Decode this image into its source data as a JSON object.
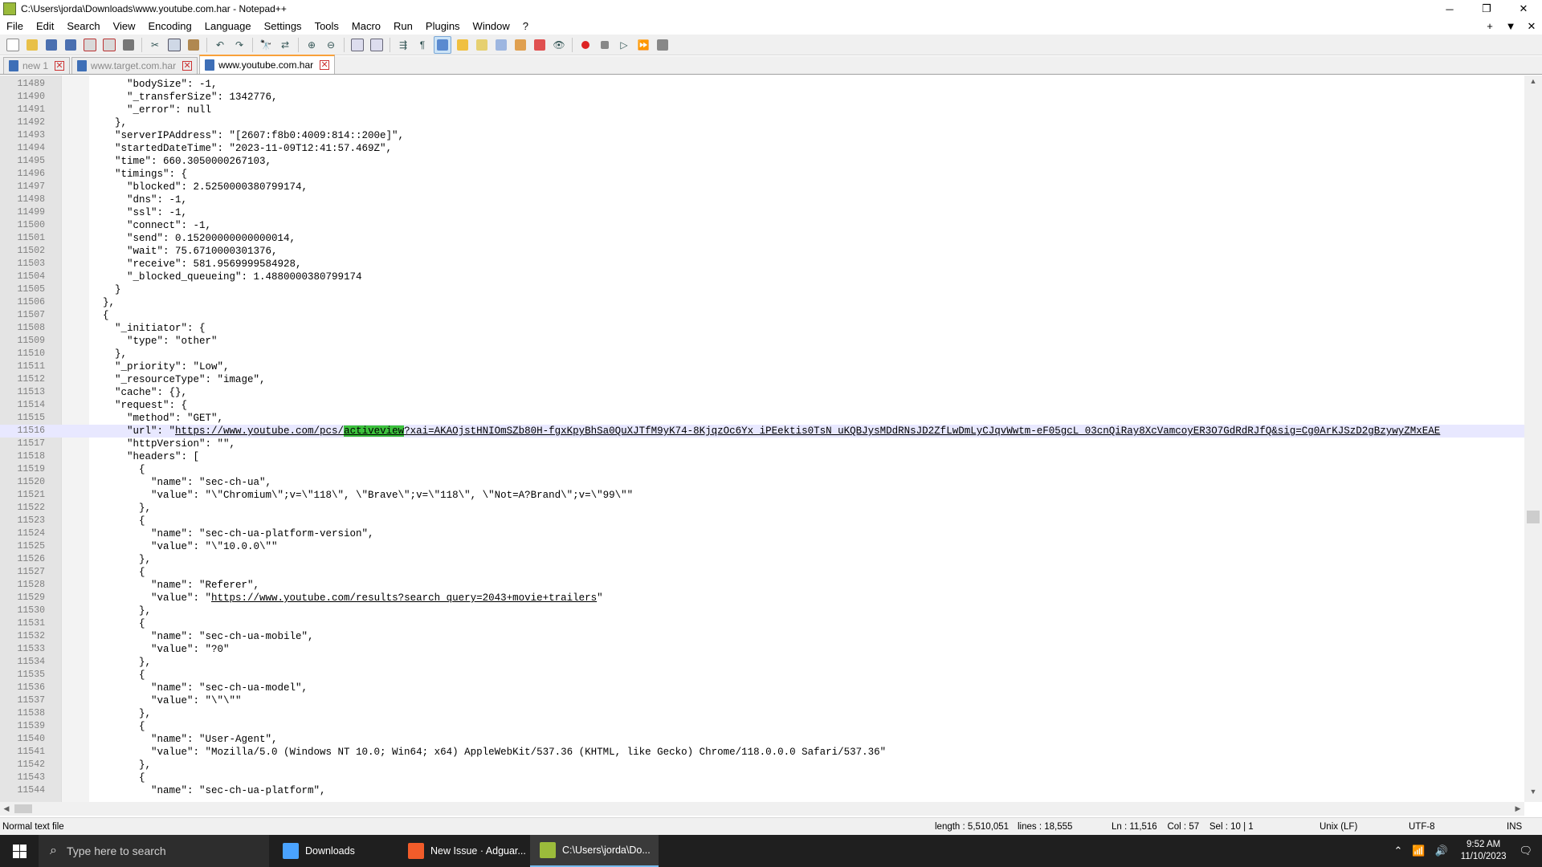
{
  "window": {
    "title": "C:\\Users\\jorda\\Downloads\\www.youtube.com.har - Notepad++",
    "minimize": "─",
    "restore": "❐",
    "close": "✕"
  },
  "menu": {
    "items": [
      "File",
      "Edit",
      "Search",
      "View",
      "Encoding",
      "Language",
      "Settings",
      "Tools",
      "Macro",
      "Run",
      "Plugins",
      "Window",
      "?"
    ],
    "right": [
      "+",
      "▼",
      "✕"
    ]
  },
  "tabs": [
    {
      "label": "new 1",
      "active": false
    },
    {
      "label": "www.target.com.har",
      "active": false
    },
    {
      "label": "www.youtube.com.har",
      "active": true
    }
  ],
  "editor": {
    "lines": [
      {
        "n": "11489",
        "t": "    \"bodySize\": -1,"
      },
      {
        "n": "11490",
        "t": "    \"_transferSize\": 1342776,"
      },
      {
        "n": "11491",
        "t": "    \"_error\": null"
      },
      {
        "n": "11492",
        "t": "  },"
      },
      {
        "n": "11493",
        "t": "  \"serverIPAddress\": \"[2607:f8b0:4009:814::200e]\","
      },
      {
        "n": "11494",
        "t": "  \"startedDateTime\": \"2023-11-09T12:41:57.469Z\","
      },
      {
        "n": "11495",
        "t": "  \"time\": 660.3050000267103,"
      },
      {
        "n": "11496",
        "t": "  \"timings\": {"
      },
      {
        "n": "11497",
        "t": "    \"blocked\": 2.5250000380799174,"
      },
      {
        "n": "11498",
        "t": "    \"dns\": -1,"
      },
      {
        "n": "11499",
        "t": "    \"ssl\": -1,"
      },
      {
        "n": "11500",
        "t": "    \"connect\": -1,"
      },
      {
        "n": "11501",
        "t": "    \"send\": 0.15200000000000014,"
      },
      {
        "n": "11502",
        "t": "    \"wait\": 75.6710000301376,"
      },
      {
        "n": "11503",
        "t": "    \"receive\": 581.9569999584928,"
      },
      {
        "n": "11504",
        "t": "    \"_blocked_queueing\": 1.4880000380799174"
      },
      {
        "n": "11505",
        "t": "  }"
      },
      {
        "n": "11506",
        "t": "},"
      },
      {
        "n": "11507",
        "t": "{"
      },
      {
        "n": "11508",
        "t": "  \"_initiator\": {"
      },
      {
        "n": "11509",
        "t": "    \"type\": \"other\""
      },
      {
        "n": "11510",
        "t": "  },"
      },
      {
        "n": "11511",
        "t": "  \"_priority\": \"Low\","
      },
      {
        "n": "11512",
        "t": "  \"_resourceType\": \"image\","
      },
      {
        "n": "11513",
        "t": "  \"cache\": {},"
      },
      {
        "n": "11514",
        "t": "  \"request\": {"
      },
      {
        "n": "11515",
        "t": "    \"method\": \"GET\","
      },
      {
        "n": "11516",
        "t": "    \"url\": \"",
        "url_pre": "https://www.youtube.com/pcs/",
        "url_hl": "activeview",
        "url_post": "?xai=AKAOjstHNIOmSZb80H-fgxKpyBhSa0QuXJTfM9yK74-8KjqzOc6Yx_iPEektis0TsN_uKQBJysMDdRNsJD2ZfLwDmLyCJqvWwtm-eF05gcL_03cnQiRay8XcVamcoyER3O7GdRdRJfQ&sig=Cg0ArKJSzD2gBzywyZMxEAE",
        "current": true
      },
      {
        "n": "11517",
        "t": "    \"httpVersion\": \"\","
      },
      {
        "n": "11518",
        "t": "    \"headers\": ["
      },
      {
        "n": "11519",
        "t": "      {"
      },
      {
        "n": "11520",
        "t": "        \"name\": \"sec-ch-ua\","
      },
      {
        "n": "11521",
        "t": "        \"value\": \"\\\"Chromium\\\";v=\\\"118\\\", \\\"Brave\\\";v=\\\"118\\\", \\\"Not=A?Brand\\\";v=\\\"99\\\"\""
      },
      {
        "n": "11522",
        "t": "      },"
      },
      {
        "n": "11523",
        "t": "      {"
      },
      {
        "n": "11524",
        "t": "        \"name\": \"sec-ch-ua-platform-version\","
      },
      {
        "n": "11525",
        "t": "        \"value\": \"\\\"10.0.0\\\"\""
      },
      {
        "n": "11526",
        "t": "      },"
      },
      {
        "n": "11527",
        "t": "      {"
      },
      {
        "n": "11528",
        "t": "        \"name\": \"Referer\","
      },
      {
        "n": "11529",
        "t": "        \"value\": \"",
        "link": "https://www.youtube.com/results?search_query=2043+movie+trailers",
        "after": "\""
      },
      {
        "n": "11530",
        "t": "      },"
      },
      {
        "n": "11531",
        "t": "      {"
      },
      {
        "n": "11532",
        "t": "        \"name\": \"sec-ch-ua-mobile\","
      },
      {
        "n": "11533",
        "t": "        \"value\": \"?0\""
      },
      {
        "n": "11534",
        "t": "      },"
      },
      {
        "n": "11535",
        "t": "      {"
      },
      {
        "n": "11536",
        "t": "        \"name\": \"sec-ch-ua-model\","
      },
      {
        "n": "11537",
        "t": "        \"value\": \"\\\"\\\"\""
      },
      {
        "n": "11538",
        "t": "      },"
      },
      {
        "n": "11539",
        "t": "      {"
      },
      {
        "n": "11540",
        "t": "        \"name\": \"User-Agent\","
      },
      {
        "n": "11541",
        "t": "        \"value\": \"Mozilla/5.0 (Windows NT 10.0; Win64; x64) AppleWebKit/537.36 (KHTML, like Gecko) Chrome/118.0.0.0 Safari/537.36\""
      },
      {
        "n": "11542",
        "t": "      },"
      },
      {
        "n": "11543",
        "t": "      {"
      },
      {
        "n": "11544",
        "t": "        \"name\": \"sec-ch-ua-platform\","
      }
    ]
  },
  "status": {
    "filetype": "Normal text file",
    "length": "length : 5,510,051",
    "lines": "lines : 18,555",
    "position": "Ln : 11,516    Col : 57    Sel : 10 | 1",
    "eol": "Unix (LF)",
    "encoding": "UTF-8",
    "mode": "INS"
  },
  "taskbar": {
    "search_placeholder": "Type here to search",
    "apps": [
      {
        "label": "Downloads",
        "icon": "folder-icon",
        "color": "#4aa3ff"
      },
      {
        "label": "New Issue · Adguar...",
        "icon": "brave-icon",
        "color": "#f25c2a"
      },
      {
        "label": "C:\\Users\\jorda\\Do...",
        "icon": "notepadpp-icon",
        "color": "#9bbb3b"
      }
    ],
    "time": "9:52 AM",
    "date": "11/10/2023"
  },
  "colors": {
    "highlight": "#3cc03c",
    "current_line": "#e8e8ff",
    "taskbar": "#1f1f1f"
  }
}
